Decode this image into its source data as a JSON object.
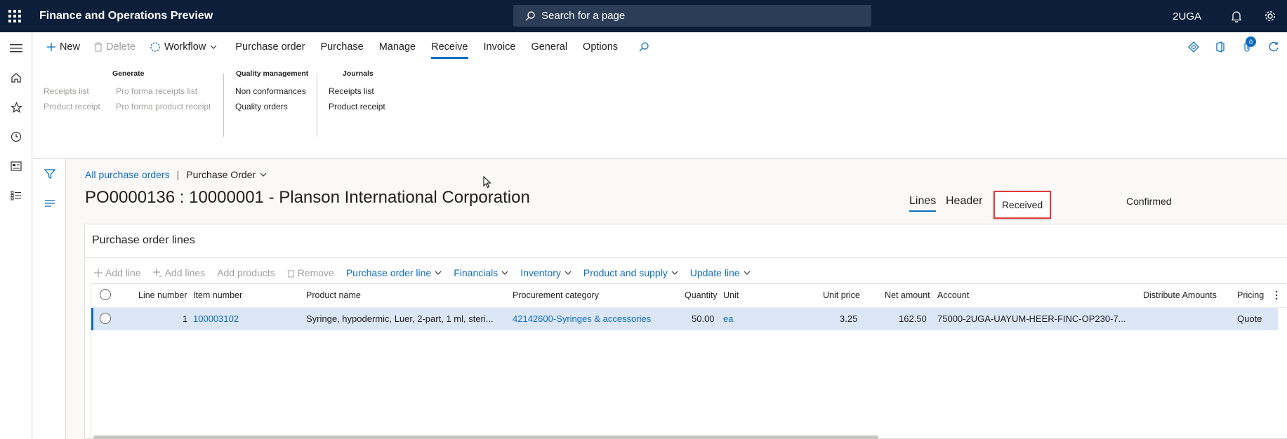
{
  "topbar": {
    "app_title": "Finance and Operations Preview",
    "search_placeholder": "Search for a page",
    "company": "2UGA"
  },
  "actionpane": {
    "new_label": "New",
    "delete_label": "Delete",
    "workflow_label": "Workflow",
    "tabs": [
      "Purchase order",
      "Purchase",
      "Manage",
      "Receive",
      "Invoice",
      "General",
      "Options"
    ],
    "active_tab": "Receive",
    "notification_count": "0",
    "groups": {
      "generate": {
        "title": "Generate",
        "items": [
          "Receipts list",
          "Product receipt",
          "Pro forma receipts list",
          "Pro forma product receipt"
        ]
      },
      "quality": {
        "title": "Quality management",
        "items": [
          "Non conformances",
          "Quality orders"
        ]
      },
      "journals": {
        "title": "Journals",
        "items": [
          "Receipts list",
          "Product receipt"
        ]
      }
    }
  },
  "breadcrumb": {
    "link": "All purchase orders",
    "separator": "|",
    "current": "Purchase Order"
  },
  "page_title": "PO0000136 : 10000001 - Planson International Corporation",
  "views": {
    "lines": "Lines",
    "header": "Header",
    "received": "Received",
    "confirmed": "Confirmed"
  },
  "fasttab": {
    "title": "Purchase order lines",
    "actions": {
      "add_line": "Add line",
      "add_lines": "Add lines",
      "add_products": "Add products",
      "remove": "Remove",
      "po_line": "Purchase order line",
      "financials": "Financials",
      "inventory": "Inventory",
      "product_supply": "Product and supply",
      "update_line": "Update line"
    },
    "columns": {
      "line_number": "Line number",
      "item_number": "Item number",
      "product_name": "Product name",
      "procurement_category": "Procurement category",
      "quantity": "Quantity",
      "unit": "Unit",
      "unit_price": "Unit price",
      "net_amount": "Net amount",
      "account": "Account",
      "distribute_amounts": "Distribute Amounts",
      "pricing": "Pricing"
    },
    "rows": [
      {
        "line_number": "1",
        "item_number": "100003102",
        "product_name": "Syringe, hypodermic, Luer, 2-part, 1 ml, steri...",
        "procurement_category": "42142600-Syringes & accessories",
        "quantity": "50.00",
        "unit": "ea",
        "unit_price": "3.25",
        "net_amount": "162.50",
        "account": "75000-2UGA-UAYUM-HEER-FINC-OP230-7...",
        "distribute_amounts": "",
        "pricing": "Quote"
      }
    ]
  },
  "colors": {
    "topbar_bg": "#0b1f3a",
    "accent": "#0f6cbd",
    "selected_row": "#dbe6f7",
    "highlight_box": "#e03a3a"
  }
}
